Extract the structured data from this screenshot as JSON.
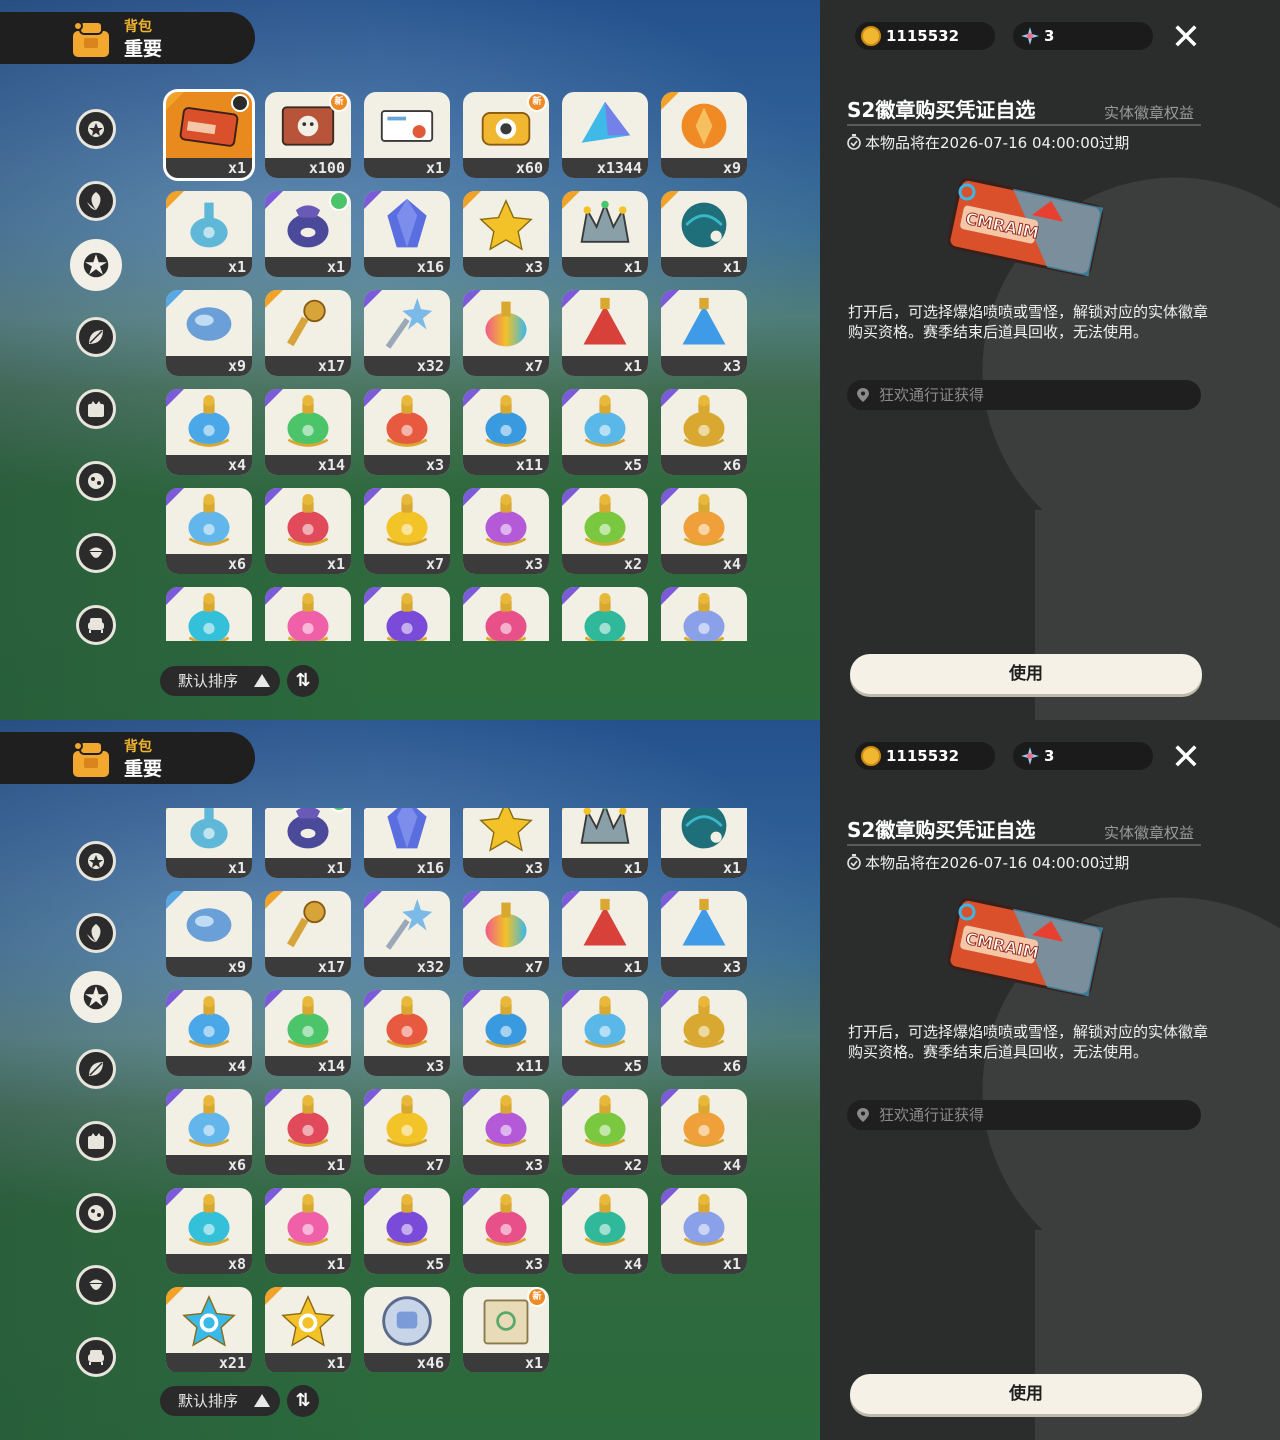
{
  "header": {
    "sub": "背包",
    "title": "重要"
  },
  "currency": {
    "coins": "1115532",
    "gems": "3"
  },
  "sort": {
    "label": "默认排序"
  },
  "detail": {
    "title": "S2徽章购买凭证自选",
    "tag": "实体徽章权益",
    "expire": "本物品将在2026-07-16 04:00:00过期",
    "description": "打开后，可选择爆焰喷喷或雪怪，解锁对应的实体徽章购买资格。赛季结束后道具回收，无法使用。",
    "source": "狂欢通行证获得",
    "use_label": "使用",
    "art_text": "CMRAIM"
  },
  "new_badge": "新",
  "categories": [
    "star-badge-icon",
    "leaf-icon",
    "sun-gear-icon",
    "leaves-icon",
    "crown-scroll-icon",
    "star-ball-icon",
    "acorn-icon",
    "sofa-icon"
  ],
  "items": [
    {
      "icon": "ticket",
      "rarity": "orange",
      "count": "x1",
      "color": "#d9502a",
      "selected": true,
      "badge": "check"
    },
    {
      "icon": "card",
      "rarity": "none",
      "count": "x100",
      "color": "#b8543a",
      "badge": "new"
    },
    {
      "icon": "letter",
      "rarity": "none",
      "count": "x1",
      "color": "#6aa6d8"
    },
    {
      "icon": "camera",
      "rarity": "none",
      "count": "x60",
      "color": "#f2b730",
      "badge": "new"
    },
    {
      "icon": "prism",
      "rarity": "none",
      "count": "x1344",
      "color": "#3fb9e8"
    },
    {
      "icon": "orange-gem",
      "rarity": "orange",
      "count": "x9",
      "color": "#f08a24"
    },
    {
      "icon": "flask",
      "rarity": "orange",
      "count": "x1",
      "color": "#5fb8d8"
    },
    {
      "icon": "pouch",
      "rarity": "purple",
      "count": "x1",
      "color": "#4b4a9a",
      "badge": "green"
    },
    {
      "icon": "crystal",
      "rarity": "purple",
      "count": "x16",
      "color": "#5a6ee0"
    },
    {
      "icon": "star",
      "rarity": "orange",
      "count": "x3",
      "color": "#f2c228"
    },
    {
      "icon": "crown",
      "rarity": "orange",
      "count": "x1",
      "color": "#8aa0a8"
    },
    {
      "icon": "shell",
      "rarity": "orange",
      "count": "x1",
      "color": "#1f6f7a"
    },
    {
      "icon": "blue-stone",
      "rarity": "blue",
      "count": "x9",
      "color": "#6a9fd8"
    },
    {
      "icon": "key",
      "rarity": "orange",
      "count": "x17",
      "color": "#d7a43a"
    },
    {
      "icon": "wand",
      "rarity": "purple",
      "count": "x32",
      "color": "#7bb9e8"
    },
    {
      "icon": "rainbow-bottle",
      "rarity": "purple",
      "count": "x7",
      "color": "#9a6ad8"
    },
    {
      "icon": "red-bottle",
      "rarity": "purple",
      "count": "x1",
      "color": "#d8403a"
    },
    {
      "icon": "blue-bottle",
      "rarity": "purple",
      "count": "x3",
      "color": "#3f9ae8"
    },
    {
      "icon": "potion",
      "rarity": "purple",
      "count": "x4",
      "color": "#4aa8e8"
    },
    {
      "icon": "potion",
      "rarity": "purple",
      "count": "x14",
      "color": "#4cc46a"
    },
    {
      "icon": "potion",
      "rarity": "purple",
      "count": "x3",
      "color": "#e85a40"
    },
    {
      "icon": "potion",
      "rarity": "purple",
      "count": "x11",
      "color": "#3a9ae0"
    },
    {
      "icon": "potion",
      "rarity": "purple",
      "count": "x5",
      "color": "#5ab8e8"
    },
    {
      "icon": "potion",
      "rarity": "purple",
      "count": "x6",
      "color": "#d8a830"
    },
    {
      "icon": "potion",
      "rarity": "purple",
      "count": "x6",
      "color": "#62b6ec"
    },
    {
      "icon": "potion",
      "rarity": "purple",
      "count": "x1",
      "color": "#e04a5a"
    },
    {
      "icon": "potion",
      "rarity": "purple",
      "count": "x7",
      "color": "#f2c428"
    },
    {
      "icon": "potion",
      "rarity": "purple",
      "count": "x3",
      "color": "#b45ad8"
    },
    {
      "icon": "potion",
      "rarity": "purple",
      "count": "x2",
      "color": "#7ac840"
    },
    {
      "icon": "potion",
      "rarity": "purple",
      "count": "x4",
      "color": "#f0a03a"
    },
    {
      "icon": "potion",
      "rarity": "purple",
      "count": "x8",
      "color": "#34c0d8"
    },
    {
      "icon": "potion",
      "rarity": "purple",
      "count": "x1",
      "color": "#f060a8"
    },
    {
      "icon": "potion",
      "rarity": "purple",
      "count": "x5",
      "color": "#7a4ad8"
    },
    {
      "icon": "potion",
      "rarity": "purple",
      "count": "x3",
      "color": "#e8508a"
    },
    {
      "icon": "potion",
      "rarity": "purple",
      "count": "x4",
      "color": "#30b89a"
    },
    {
      "icon": "potion",
      "rarity": "purple",
      "count": "x1",
      "color": "#8aa0e8"
    },
    {
      "icon": "blue-star",
      "rarity": "orange",
      "count": "x21",
      "color": "#3ab8e8"
    },
    {
      "icon": "gold-star",
      "rarity": "orange",
      "count": "x1",
      "color": "#f2c228"
    },
    {
      "icon": "silver-coin",
      "rarity": "none",
      "count": "x46",
      "color": "#7a9ad8"
    },
    {
      "icon": "scroll",
      "rarity": "none",
      "count": "x1",
      "color": "#c9b98a",
      "badge": "new"
    }
  ]
}
